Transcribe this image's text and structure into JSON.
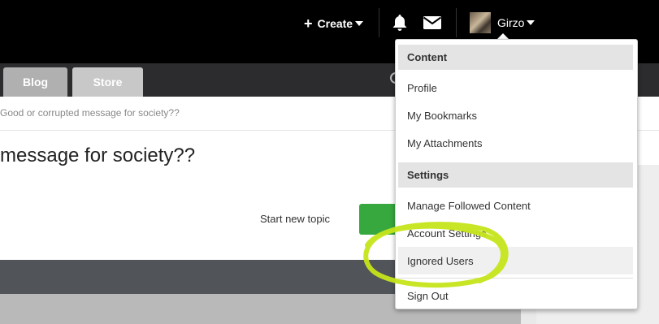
{
  "header": {
    "create_label": "Create",
    "user_name": "Girzo"
  },
  "nav": {
    "tabs": [
      {
        "label": "Blog"
      },
      {
        "label": "Store"
      }
    ]
  },
  "main": {
    "breadcrumb": "Good or corrupted message for society??",
    "title": "message for society??",
    "start_topic_label": "Start new topic"
  },
  "user_menu": {
    "content_heading": "Content",
    "content_items": [
      "Profile",
      "My Bookmarks",
      "My Attachments"
    ],
    "settings_heading": "Settings",
    "settings_items": [
      "Manage Followed Content",
      "Account Settings",
      "Ignored Users"
    ],
    "signout_label": "Sign Out"
  },
  "icons": {
    "create": "plus-icon",
    "notifications": "bell-icon",
    "messages": "envelope-icon",
    "dropdown": "caret-down-icon"
  },
  "colors": {
    "topbar": "#000000",
    "nav": "#2c2c2e",
    "start_button": "#36a83e",
    "highlight_scribble": "#c6e51a",
    "menu_heading_bg": "#e4e4e4"
  }
}
